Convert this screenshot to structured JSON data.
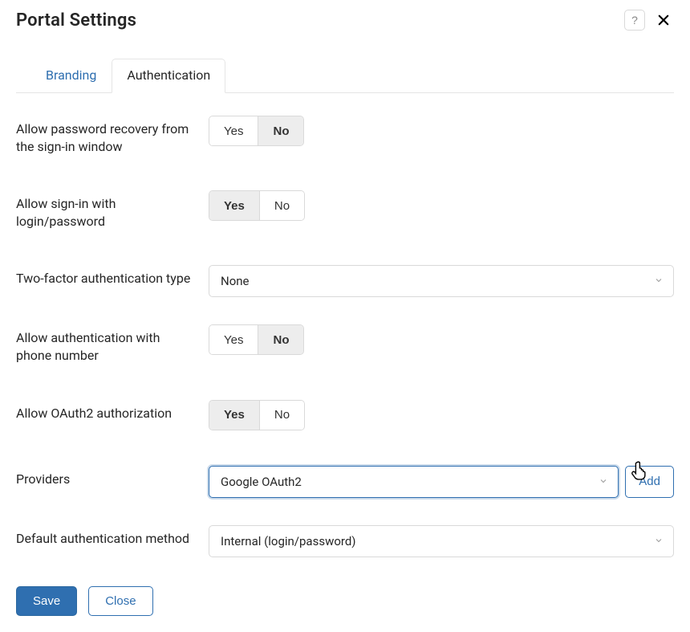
{
  "header": {
    "title": "Portal Settings",
    "help_tooltip": "Help",
    "close_tooltip": "Close"
  },
  "tabs": {
    "branding": "Branding",
    "authentication": "Authentication",
    "active": "authentication"
  },
  "labels": {
    "yes": "Yes",
    "no": "No"
  },
  "form": {
    "allow_password_recovery": {
      "label": "Allow password recovery from the sign-in window",
      "value": "No"
    },
    "allow_login_password": {
      "label": "Allow sign-in with login/password",
      "value": "Yes"
    },
    "two_factor_type": {
      "label": "Two-factor authentication type",
      "value": "None"
    },
    "allow_phone_auth": {
      "label": "Allow authentication with phone number",
      "value": "No"
    },
    "allow_oauth2": {
      "label": "Allow OAuth2 authorization",
      "value": "Yes"
    },
    "providers": {
      "label": "Providers",
      "value": "Google OAuth2",
      "add_label": "Add"
    },
    "default_auth_method": {
      "label": "Default authentication method",
      "value": "Internal (login/password)"
    }
  },
  "footer": {
    "save": "Save",
    "close": "Close"
  }
}
